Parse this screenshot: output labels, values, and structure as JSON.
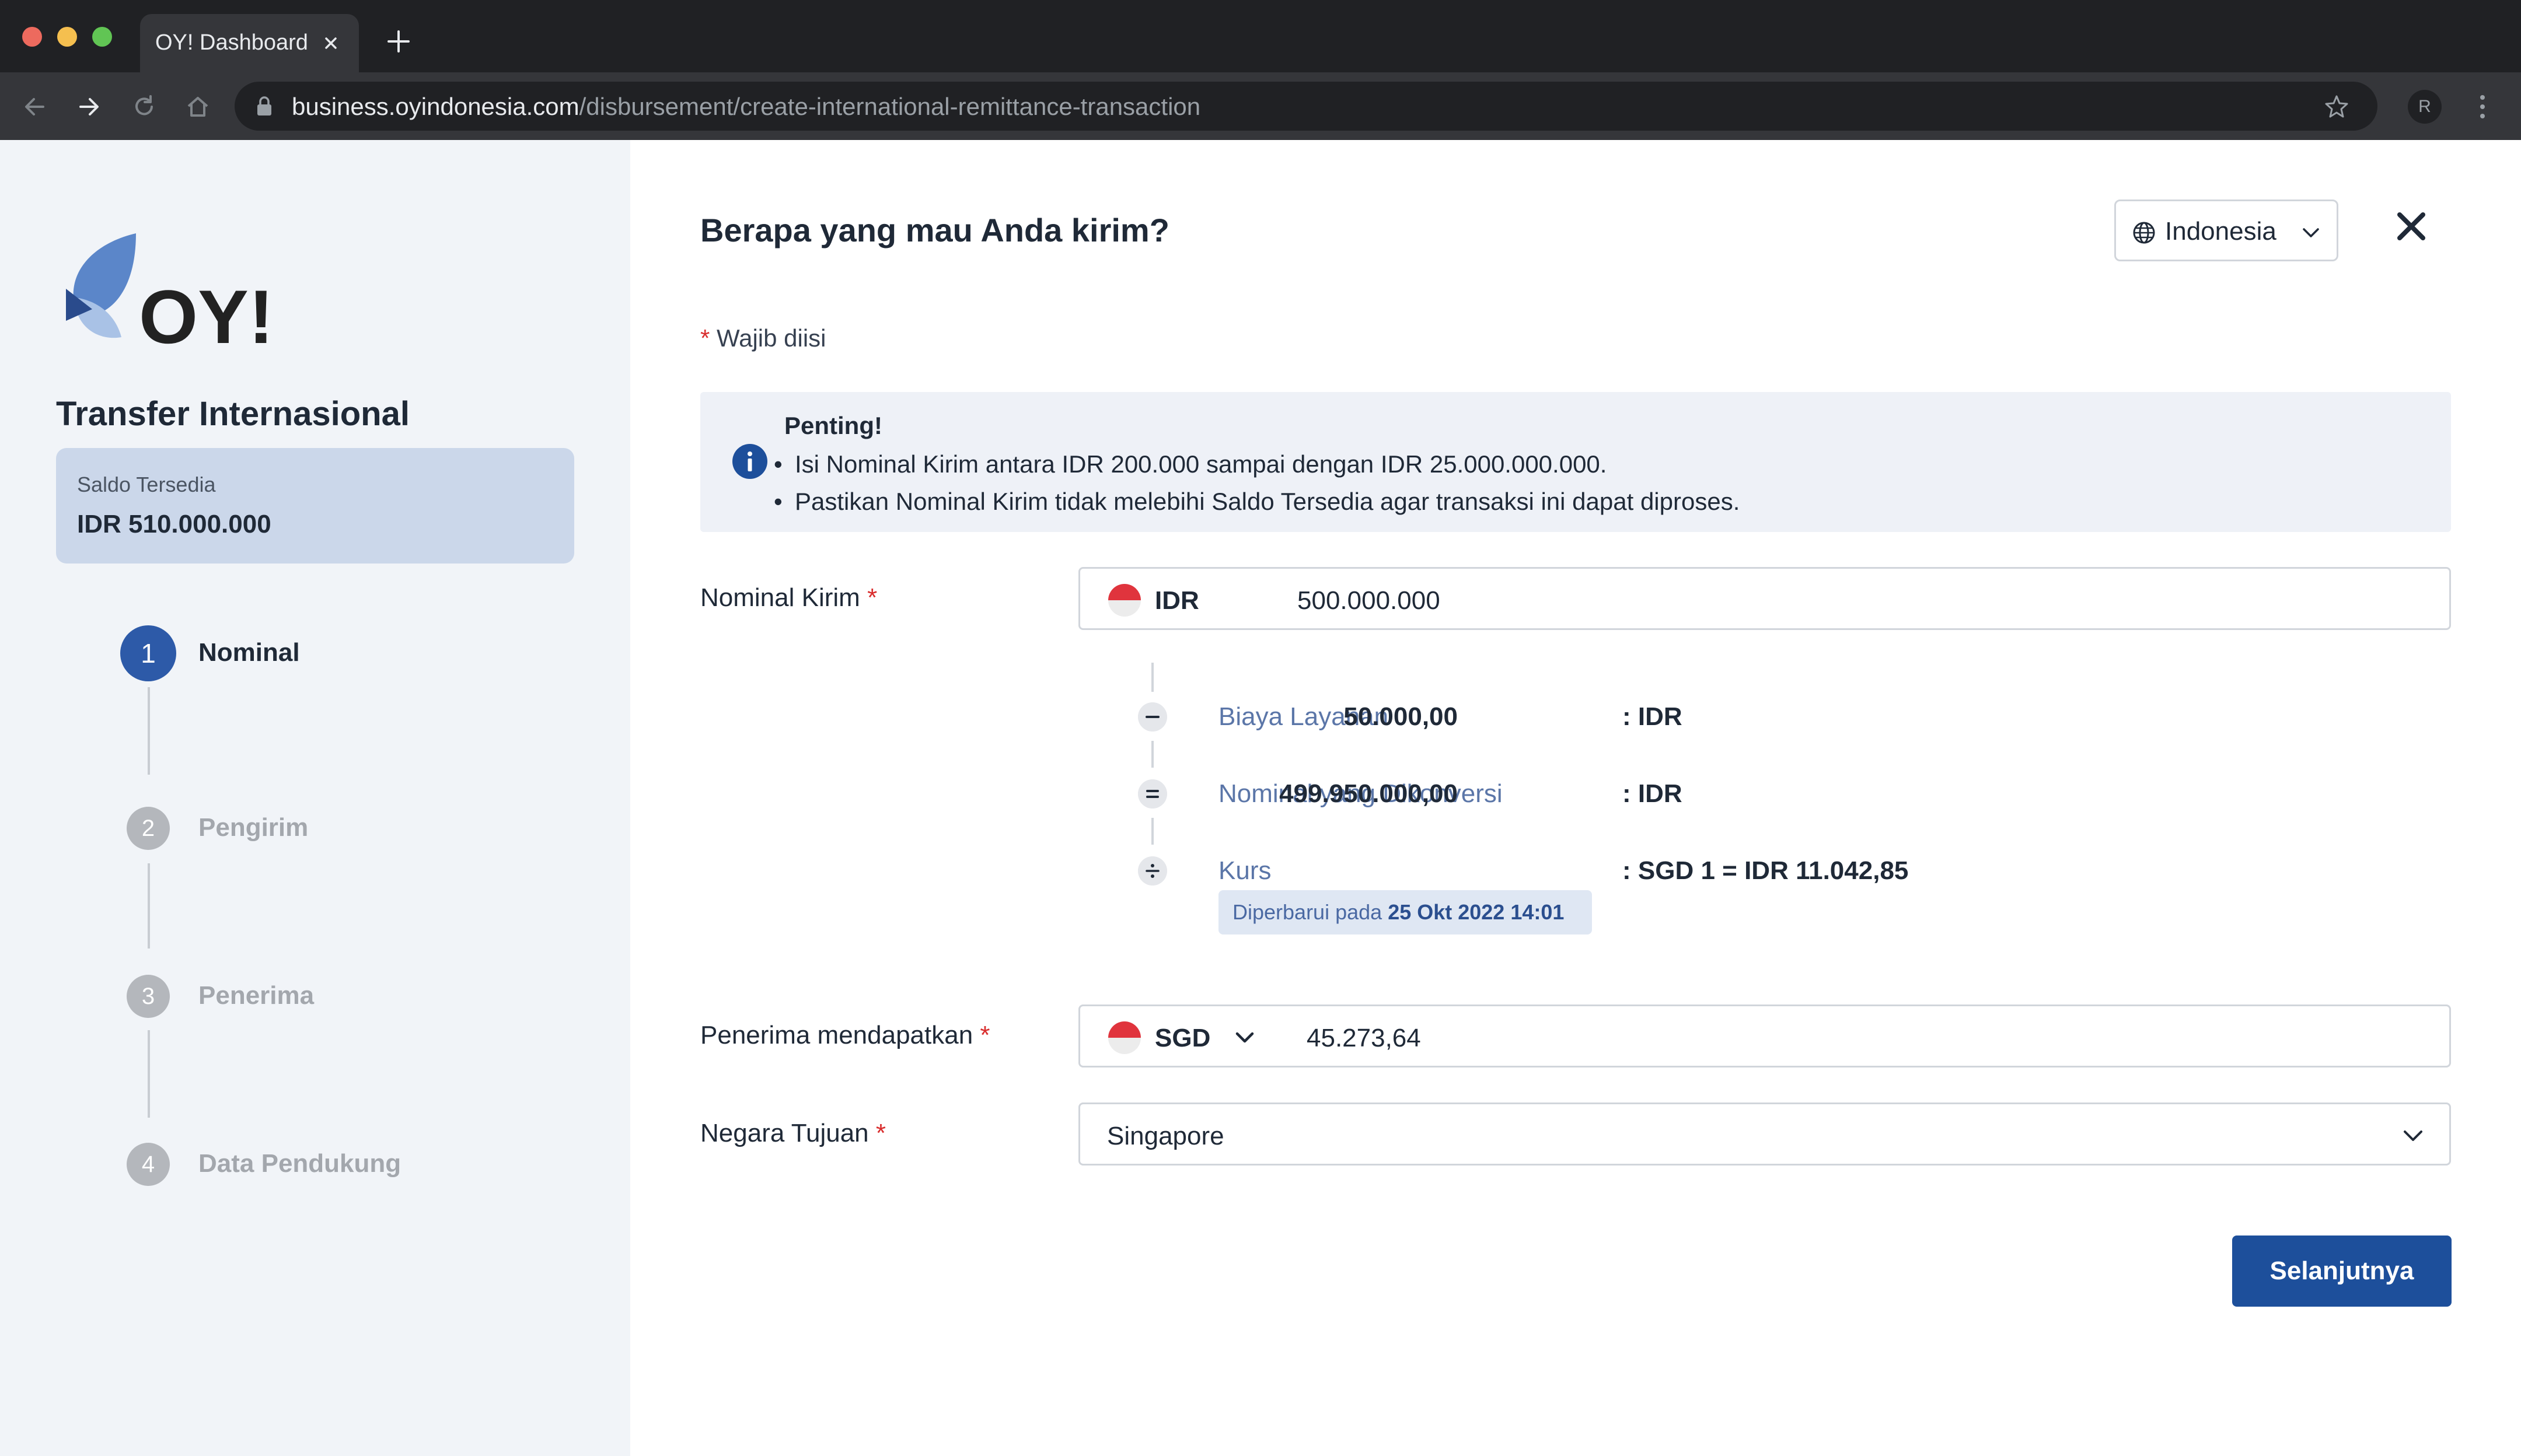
{
  "browser": {
    "tab_title": "OY! Dashboard",
    "url_host": "business.oyindonesia.com",
    "url_path": "/disbursement/create-international-remittance-transaction",
    "profile_initial": "R"
  },
  "sidebar": {
    "title": "Transfer Internasional",
    "balance_label": "Saldo Tersedia",
    "balance_value": "IDR 510.000.000",
    "steps": [
      {
        "number": "1",
        "label": "Nominal",
        "state": "active"
      },
      {
        "number": "2",
        "label": "Pengirim",
        "state": "inactive"
      },
      {
        "number": "3",
        "label": "Penerima",
        "state": "inactive"
      },
      {
        "number": "4",
        "label": "Data Pendukung",
        "state": "inactive"
      }
    ]
  },
  "main": {
    "heading": "Berapa yang mau Anda kirim?",
    "language": "Indonesia",
    "required_star": "*",
    "required_note": "Wajib diisi",
    "notice": {
      "title": "Penting!",
      "items": [
        "Isi Nominal Kirim antara IDR 200.000 sampai dengan IDR 25.000.000.000.",
        "Pastikan Nominal Kirim tidak melebihi Saldo Tersedia agar transaksi ini dapat diproses."
      ]
    },
    "send": {
      "label": "Nominal Kirim",
      "currency": "IDR",
      "amount": "500.000.000"
    },
    "breakdown": {
      "fee_label": "Biaya Layanan",
      "fee_currency": ": IDR",
      "fee_value": "50.000,00",
      "converted_label": "Nominal yang Dikonversi",
      "converted_currency": ": IDR",
      "converted_value": "499.950.000,00",
      "rate_label": "Kurs",
      "rate_value": ": SGD 1 = IDR 11.042,85",
      "updated_prefix": "Diperbarui pada",
      "updated_date": "25 Okt 2022 14:01"
    },
    "receive": {
      "label": "Penerima mendapatkan",
      "currency": "SGD",
      "amount": "45.273,64"
    },
    "country": {
      "label": "Negara Tujuan",
      "value": "Singapore"
    },
    "next_button": "Selanjutnya"
  },
  "colors": {
    "primary": "#1d4f9b",
    "step_active": "#2d5aa8",
    "required": "#d92d2d",
    "balance_bg": "#cbd7ea"
  }
}
